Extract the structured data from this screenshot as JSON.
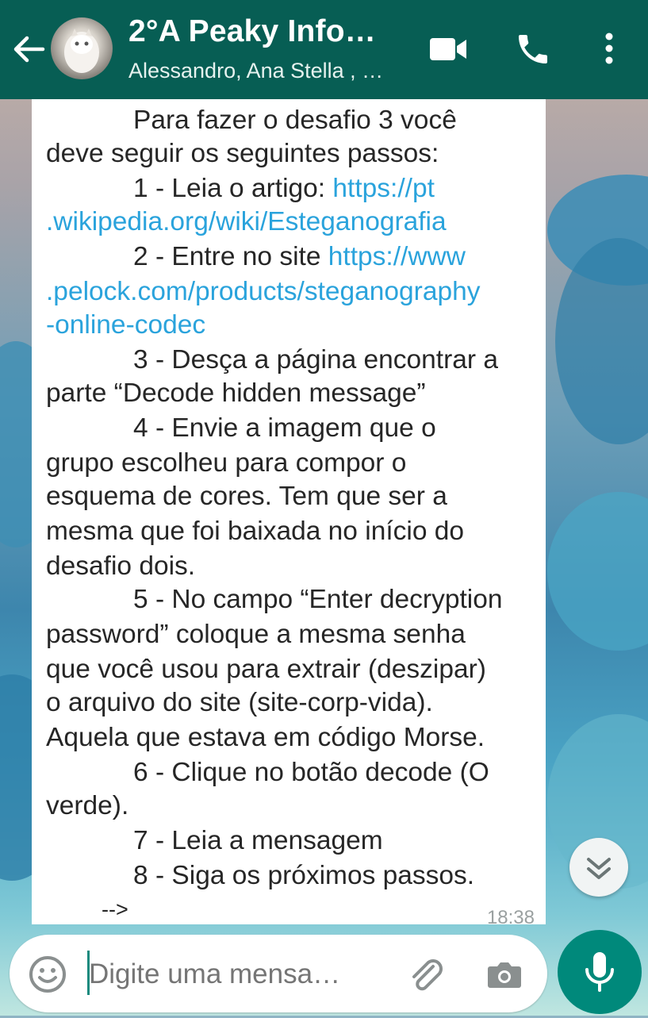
{
  "header": {
    "title": "2°A Peaky Info…",
    "subtitle": "Alessandro, Ana Stella , …",
    "icons": [
      "back-arrow-icon",
      "video-call-icon",
      "voice-call-icon",
      "more-options-icon"
    ]
  },
  "message": {
    "lines": [
      {
        "indent": true,
        "parts": [
          {
            "text": "Para fazer o desafio 3 você"
          }
        ]
      },
      {
        "indent": false,
        "parts": [
          {
            "text": "deve seguir os seguintes passos:"
          }
        ]
      },
      {
        "indent": true,
        "parts": [
          {
            "text": "1 - Leia o artigo: "
          },
          {
            "text": "https://pt",
            "link": true
          }
        ]
      },
      {
        "indent": false,
        "parts": [
          {
            "text": ".wikipedia.org/wiki/Esteganografia",
            "link": true
          }
        ]
      },
      {
        "indent": true,
        "parts": [
          {
            "text": "2 - Entre no site "
          },
          {
            "text": "https://www",
            "link": true
          }
        ]
      },
      {
        "indent": false,
        "parts": [
          {
            "text": ".pelock.com/products/steganography",
            "link": true
          }
        ]
      },
      {
        "indent": false,
        "parts": [
          {
            "text": "-online-codec",
            "link": true
          }
        ]
      },
      {
        "indent": true,
        "parts": [
          {
            "text": "3 - Desça a página encontrar a"
          }
        ]
      },
      {
        "indent": false,
        "parts": [
          {
            "text": "parte “Decode hidden message”"
          }
        ]
      },
      {
        "indent": true,
        "parts": [
          {
            "text": "4 - Envie a imagem que o"
          }
        ]
      },
      {
        "indent": false,
        "parts": [
          {
            "text": "grupo escolheu para compor o"
          }
        ]
      },
      {
        "indent": false,
        "parts": [
          {
            "text": "esquema de cores. Tem que ser a"
          }
        ]
      },
      {
        "indent": false,
        "parts": [
          {
            "text": "mesma que foi baixada no início do"
          }
        ]
      },
      {
        "indent": false,
        "parts": [
          {
            "text": "desafio dois."
          }
        ]
      },
      {
        "indent": true,
        "parts": [
          {
            "text": "5 - No campo “Enter decryption"
          }
        ]
      },
      {
        "indent": false,
        "parts": [
          {
            "text": "password” coloque a mesma senha"
          }
        ]
      },
      {
        "indent": false,
        "parts": [
          {
            "text": "que você usou para extrair (deszipar)"
          }
        ]
      },
      {
        "indent": false,
        "parts": [
          {
            "text": "o arquivo do site (site-corp-vida)."
          }
        ]
      },
      {
        "indent": false,
        "parts": [
          {
            "text": "Aquela que estava em código Morse."
          }
        ]
      },
      {
        "indent": true,
        "parts": [
          {
            "text": "6 - Clique no botão decode (O"
          }
        ]
      },
      {
        "indent": false,
        "parts": [
          {
            "text": "verde)."
          }
        ]
      },
      {
        "indent": true,
        "parts": [
          {
            "text": "7 - Leia a mensagem"
          }
        ]
      },
      {
        "indent": true,
        "parts": [
          {
            "text": "8 - Siga os próximos passos."
          }
        ]
      }
    ],
    "arrow": "-->",
    "time": "18:38"
  },
  "composer": {
    "placeholder": "Digite uma mensa…",
    "icons": [
      "emoji-icon",
      "attach-icon",
      "camera-icon",
      "mic-icon"
    ]
  },
  "scroll_button": {
    "icon": "double-chevron-down-icon"
  },
  "colors": {
    "header_bg": "#075e54",
    "link": "#2aa3dc",
    "mic_bg": "#00897b"
  }
}
